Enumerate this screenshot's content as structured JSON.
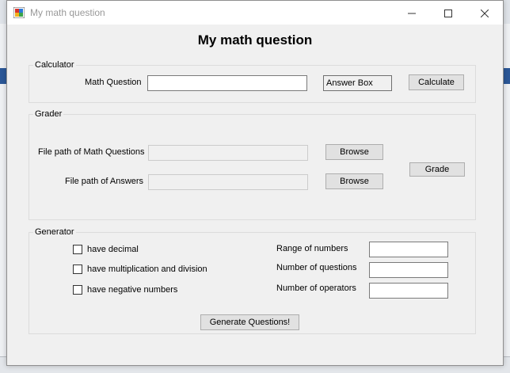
{
  "window": {
    "title": "My math question"
  },
  "heading": "My math question",
  "calculator": {
    "group_label": "Calculator",
    "question_label": "Math Question",
    "question_value": "",
    "answer_label": "Answer Box",
    "calculate_label": "Calculate"
  },
  "grader": {
    "group_label": "Grader",
    "questions_path_label": "File path of Math Questions",
    "questions_path_value": "",
    "answers_path_label": "File path of Answers",
    "answers_path_value": "",
    "browse_label": "Browse",
    "grade_label": "Grade"
  },
  "generator": {
    "group_label": "Generator",
    "options": [
      {
        "label": "have decimal",
        "checked": false
      },
      {
        "label": "have multiplication and division",
        "checked": false
      },
      {
        "label": "have negative numbers",
        "checked": false
      }
    ],
    "range_label": "Range of numbers",
    "range_value": "",
    "count_label": "Number of questions",
    "count_value": "",
    "operators_label": "Number of operators",
    "operators_value": "",
    "generate_label": "Generate Questions!"
  },
  "colors": {
    "window_bg": "#f0f0f0",
    "titlebar_bg": "#ffffff",
    "button_bg": "#e1e1e1"
  }
}
